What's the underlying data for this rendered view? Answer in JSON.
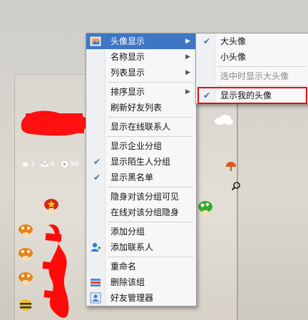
{
  "stats": {
    "stars": "1",
    "mail": "4",
    "gear": "94"
  },
  "menu_main": {
    "items": [
      {
        "label": "头像显示",
        "submenu": true,
        "highlighted": true,
        "icon": "avatar-display-icon"
      },
      {
        "label": "名称显示",
        "submenu": true
      },
      {
        "label": "列表显示",
        "submenu": true
      },
      {
        "separator": true
      },
      {
        "label": "排序显示",
        "submenu": true
      },
      {
        "label": "刷新好友列表"
      },
      {
        "separator": true
      },
      {
        "label": "显示在线联系人"
      },
      {
        "separator": true
      },
      {
        "label": "显示企业分组"
      },
      {
        "label": "显示陌生人分组",
        "checked": true
      },
      {
        "label": "显示黑名单",
        "checked": true
      },
      {
        "separator": true
      },
      {
        "label": "隐身对该分组可见"
      },
      {
        "label": "在线对该分组隐身"
      },
      {
        "separator": true
      },
      {
        "label": "添加分组"
      },
      {
        "label": "添加联系人",
        "icon": "add-contact-icon"
      },
      {
        "separator": true
      },
      {
        "label": "重命名"
      },
      {
        "label": "删除该组",
        "icon": "delete-group-icon"
      },
      {
        "label": "好友管理器",
        "icon": "friend-manager-icon"
      }
    ]
  },
  "menu_sub": {
    "items": [
      {
        "label": "大头像",
        "checked": true
      },
      {
        "label": "小头像"
      },
      {
        "label": "选中时显示大头像",
        "disabled": true
      },
      {
        "label": "显示我的头像",
        "checked": true,
        "boxed": true
      }
    ]
  },
  "colors": {
    "highlight": "#3f76c4",
    "annotation_box": "#e20f0f",
    "scribble": "#ff0a0a"
  }
}
